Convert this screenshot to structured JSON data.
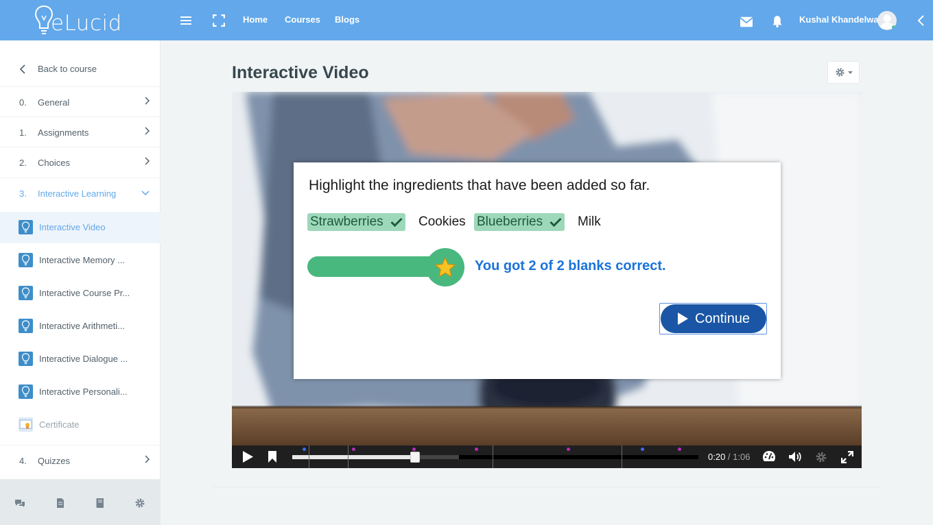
{
  "header": {
    "logo_text": "eLucid",
    "nav_links": [
      "Home",
      "Courses",
      "Blogs"
    ],
    "user_name": "Kushal Khandelwal"
  },
  "sidebar": {
    "back_label": "Back to course",
    "sections": [
      {
        "num": "0.",
        "label": "General"
      },
      {
        "num": "1.",
        "label": "Assignments"
      },
      {
        "num": "2.",
        "label": "Choices"
      },
      {
        "num": "3.",
        "label": "Interactive Learning"
      },
      {
        "num": "4.",
        "label": "Quizzes"
      }
    ],
    "items": [
      {
        "label": "Interactive Video",
        "icon": "lightbulb-icon"
      },
      {
        "label": "Interactive Memory ...",
        "icon": "lightbulb-icon"
      },
      {
        "label": "Interactive Course Pr...",
        "icon": "lightbulb-icon"
      },
      {
        "label": "Interactive Arithmeti...",
        "icon": "lightbulb-icon"
      },
      {
        "label": "Interactive Dialogue ...",
        "icon": "lightbulb-icon"
      },
      {
        "label": "Interactive Personali...",
        "icon": "lightbulb-icon"
      },
      {
        "label": "Certificate",
        "icon": "certificate-icon"
      }
    ],
    "footer_icons": [
      "chat-icon",
      "file-icon",
      "book-icon",
      "settings-icon"
    ]
  },
  "main": {
    "title": "Interactive Video"
  },
  "interaction": {
    "question": "Highlight the ingredients that have been added so far.",
    "words": [
      {
        "text": "Strawberries",
        "state": "correct"
      },
      {
        "text": "Cookies",
        "state": "plain"
      },
      {
        "text": "Blueberries",
        "state": "correct"
      },
      {
        "text": "Milk",
        "state": "plain"
      }
    ],
    "score": 2,
    "max_score": 2,
    "feedback": "You got 2 of 2 blanks correct.",
    "continue_label": "Continue"
  },
  "player": {
    "current_time": "0:20",
    "separator": " / ",
    "duration": "1:06",
    "progress": 0.303
  },
  "colors": {
    "navbar": "#62a8ea",
    "accent": "#62a8ea",
    "correct_green": "#48b87e",
    "continue_blue": "#1a56a5",
    "feedback_blue": "#1a73d9"
  }
}
